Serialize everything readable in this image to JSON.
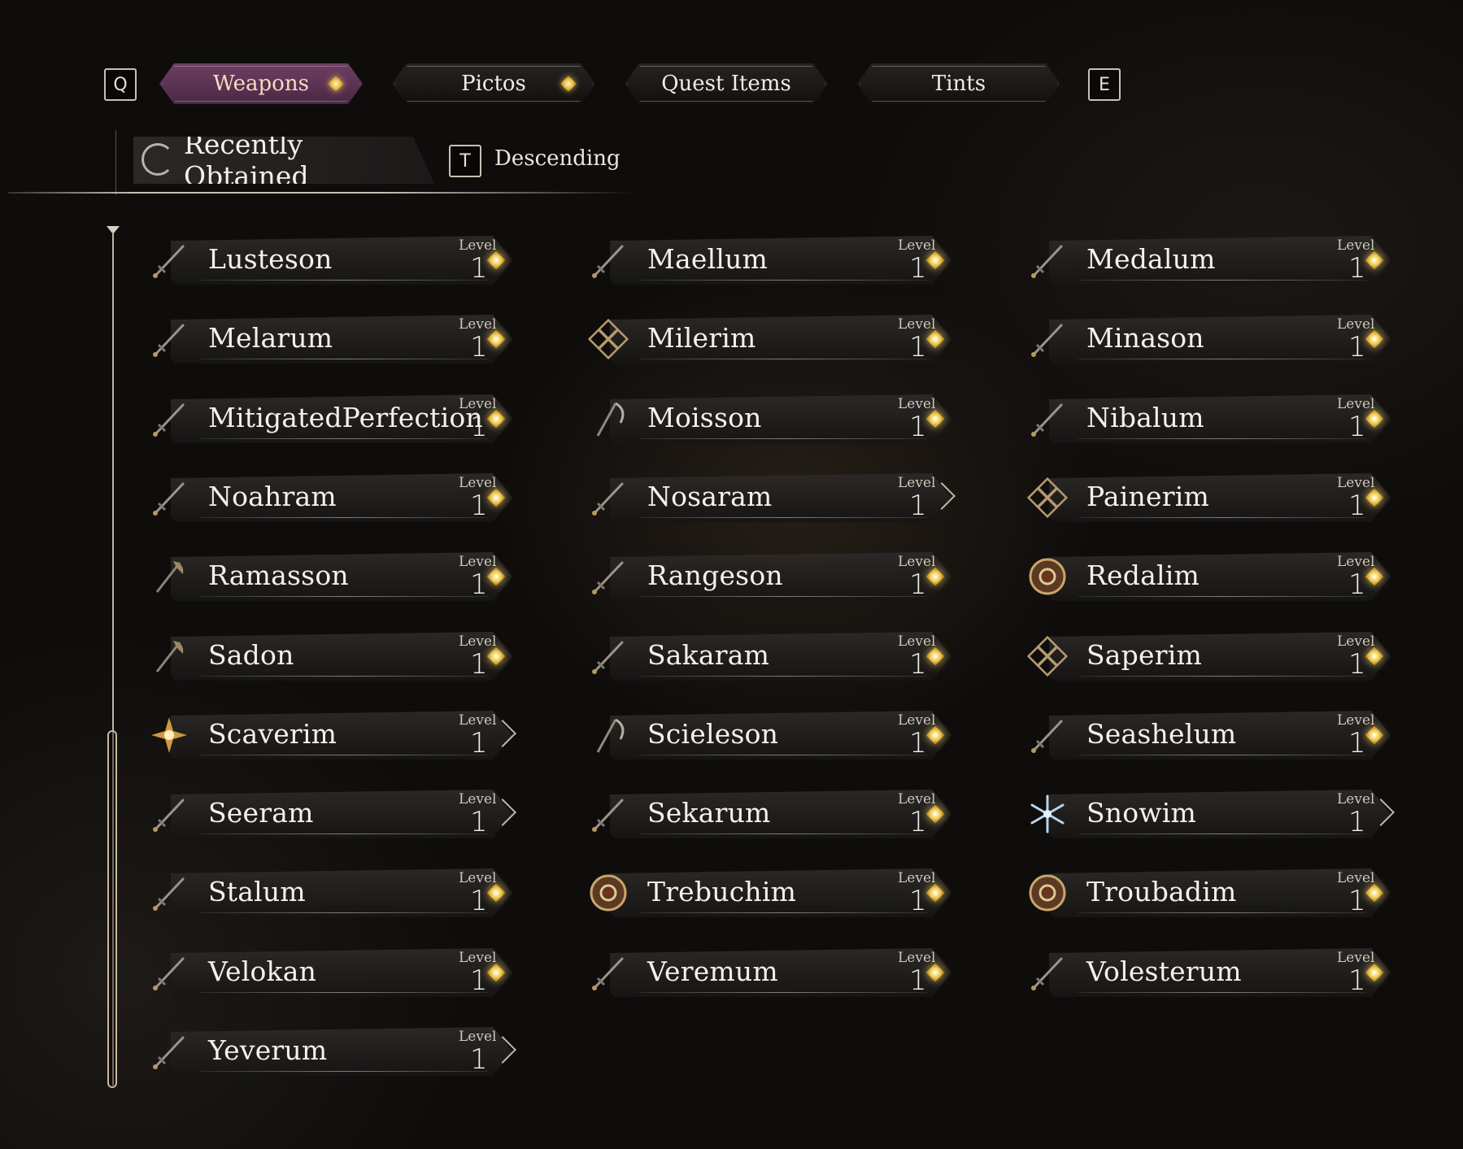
{
  "tabs": {
    "prev_key": "Q",
    "next_key": "E",
    "items": [
      {
        "label": "Weapons",
        "active": true,
        "indicator": true
      },
      {
        "label": "Pictos",
        "active": false,
        "indicator": true
      },
      {
        "label": "Quest Items",
        "active": false,
        "indicator": false
      },
      {
        "label": "Tints",
        "active": false,
        "indicator": false
      }
    ]
  },
  "sort": {
    "mode": "Recently Obtained",
    "order_key": "T",
    "order": "Descending"
  },
  "colors": {
    "active_tab": "#5e3455",
    "upgrade_indicator": "#f0c74a",
    "text": "#f5f1ea"
  },
  "weapons": [
    {
      "name": "Lusteson",
      "level_label": "Level",
      "level": "1",
      "upgrade": true,
      "icon": "sword-icon"
    },
    {
      "name": "Maellum",
      "level_label": "Level",
      "level": "1",
      "upgrade": true,
      "icon": "sword-icon"
    },
    {
      "name": "Medalum",
      "level_label": "Level",
      "level": "1",
      "upgrade": true,
      "icon": "sword-icon"
    },
    {
      "name": "Melarum",
      "level_label": "Level",
      "level": "1",
      "upgrade": true,
      "icon": "sword-icon"
    },
    {
      "name": "Milerim",
      "level_label": "Level",
      "level": "1",
      "upgrade": true,
      "icon": "emblem-icon"
    },
    {
      "name": "Minason",
      "level_label": "Level",
      "level": "1",
      "upgrade": true,
      "icon": "sword-icon"
    },
    {
      "name": "MitigatedPerfection",
      "level_label": "Level",
      "level": "1",
      "upgrade": true,
      "icon": "sword-icon"
    },
    {
      "name": "Moisson",
      "level_label": "Level",
      "level": "1",
      "upgrade": true,
      "icon": "scythe-icon"
    },
    {
      "name": "Nibalum",
      "level_label": "Level",
      "level": "1",
      "upgrade": true,
      "icon": "sword-icon"
    },
    {
      "name": "Noahram",
      "level_label": "Level",
      "level": "1",
      "upgrade": true,
      "icon": "sword-icon"
    },
    {
      "name": "Nosaram",
      "level_label": "Level",
      "level": "1",
      "upgrade": false,
      "icon": "sword-icon"
    },
    {
      "name": "Painerim",
      "level_label": "Level",
      "level": "1",
      "upgrade": true,
      "icon": "emblem-icon"
    },
    {
      "name": "Ramasson",
      "level_label": "Level",
      "level": "1",
      "upgrade": true,
      "icon": "axe-icon"
    },
    {
      "name": "Rangeson",
      "level_label": "Level",
      "level": "1",
      "upgrade": true,
      "icon": "sword-icon"
    },
    {
      "name": "Redalim",
      "level_label": "Level",
      "level": "1",
      "upgrade": true,
      "icon": "medallion-icon"
    },
    {
      "name": "Sadon",
      "level_label": "Level",
      "level": "1",
      "upgrade": true,
      "icon": "axe-icon"
    },
    {
      "name": "Sakaram",
      "level_label": "Level",
      "level": "1",
      "upgrade": true,
      "icon": "sword-icon"
    },
    {
      "name": "Saperim",
      "level_label": "Level",
      "level": "1",
      "upgrade": true,
      "icon": "emblem-icon"
    },
    {
      "name": "Scaverim",
      "level_label": "Level",
      "level": "1",
      "upgrade": false,
      "icon": "star-emblem-icon"
    },
    {
      "name": "Scieleson",
      "level_label": "Level",
      "level": "1",
      "upgrade": true,
      "icon": "scythe-icon"
    },
    {
      "name": "Seashelum",
      "level_label": "Level",
      "level": "1",
      "upgrade": true,
      "icon": "sword-icon"
    },
    {
      "name": "Seeram",
      "level_label": "Level",
      "level": "1",
      "upgrade": false,
      "icon": "sword-icon"
    },
    {
      "name": "Sekarum",
      "level_label": "Level",
      "level": "1",
      "upgrade": true,
      "icon": "sword-icon"
    },
    {
      "name": "Snowim",
      "level_label": "Level",
      "level": "1",
      "upgrade": false,
      "icon": "snowflake-icon"
    },
    {
      "name": "Stalum",
      "level_label": "Level",
      "level": "1",
      "upgrade": true,
      "icon": "sword-icon"
    },
    {
      "name": "Trebuchim",
      "level_label": "Level",
      "level": "1",
      "upgrade": true,
      "icon": "medallion-icon"
    },
    {
      "name": "Troubadim",
      "level_label": "Level",
      "level": "1",
      "upgrade": true,
      "icon": "medallion-icon"
    },
    {
      "name": "Velokan",
      "level_label": "Level",
      "level": "1",
      "upgrade": true,
      "icon": "sword-icon"
    },
    {
      "name": "Veremum",
      "level_label": "Level",
      "level": "1",
      "upgrade": true,
      "icon": "sword-icon"
    },
    {
      "name": "Volesterum",
      "level_label": "Level",
      "level": "1",
      "upgrade": true,
      "icon": "sword-icon"
    },
    {
      "name": "Yeverum",
      "level_label": "Level",
      "level": "1",
      "upgrade": false,
      "icon": "sword-icon"
    }
  ],
  "scroll": {
    "position": 0.6
  }
}
